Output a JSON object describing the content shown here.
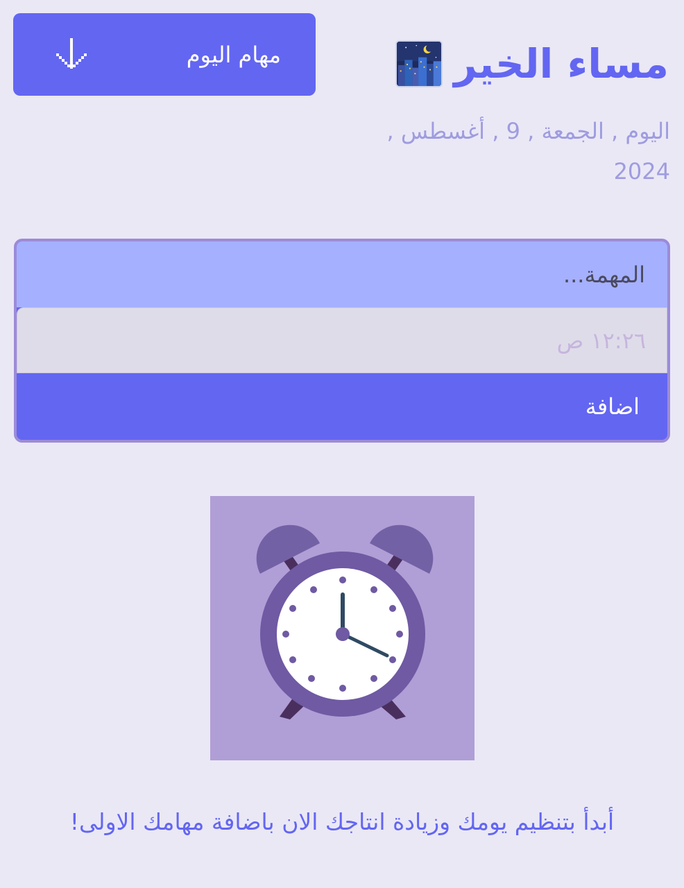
{
  "header": {
    "greeting": "مساء الخير",
    "greeting_icon": "night-city-icon",
    "date": "اليوم , الجمعة , 9 , أغسطس , 2024"
  },
  "tasks_button": {
    "label": "مهام اليوم",
    "icon": "arrow-down-icon"
  },
  "form": {
    "task_placeholder": "المهمة...",
    "time_value": "١٢:٢٦ ص",
    "add_label": "اضافة"
  },
  "illustration": {
    "icon": "alarm-clock-icon"
  },
  "empty_state": {
    "message": "أبدأ بتنظيم يومك وزيادة انتاجك الان باضافة مهامك الاولى!"
  },
  "colors": {
    "background": "#eae8f5",
    "primary": "#6366f1",
    "input_bg": "#a5b0fe",
    "time_bg": "#dfdcea",
    "date_text": "#9f9ce0",
    "illustration_bg": "#b09ed6",
    "clock_purple": "#6f5aa3"
  }
}
